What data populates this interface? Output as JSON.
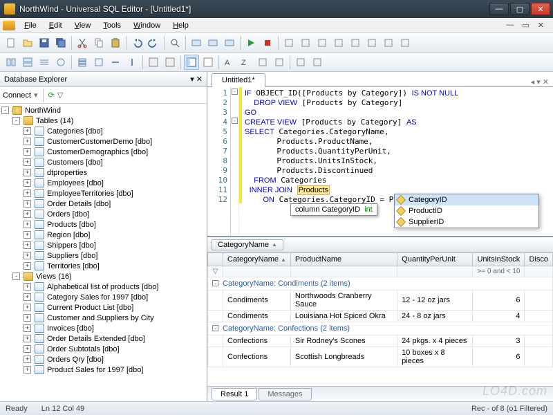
{
  "window": {
    "title": "NorthWind - Universal SQL Editor - [Untitled1*]"
  },
  "menu": [
    "File",
    "Edit",
    "View",
    "Tools",
    "Window",
    "Help"
  ],
  "sidebar": {
    "title": "Database Explorer",
    "connect_label": "Connect",
    "root": "NorthWind",
    "tables_label": "Tables (14)",
    "tables": [
      "Categories [dbo]",
      "CustomerCustomerDemo [dbo]",
      "CustomerDemographics [dbo]",
      "Customers [dbo]",
      "dtproperties",
      "Employees [dbo]",
      "EmployeeTerritories [dbo]",
      "Order Details [dbo]",
      "Orders [dbo]",
      "Products [dbo]",
      "Region [dbo]",
      "Shippers [dbo]",
      "Suppliers [dbo]",
      "Territories [dbo]"
    ],
    "views_label": "Views (16)",
    "views": [
      "Alphabetical list of products [dbo]",
      "Category Sales for 1997 [dbo]",
      "Current Product List [dbo]",
      "Customer and Suppliers by City",
      "Invoices [dbo]",
      "Order Details Extended [dbo]",
      "Order Subtotals [dbo]",
      "Orders Qry [dbo]",
      "Product Sales for 1997 [dbo]"
    ]
  },
  "editor": {
    "tab": "Untitled1*",
    "lines": [
      {
        "n": 1,
        "html": "<span class='kw'>IF</span> OBJECT_ID([Products by Category]) <span class='kw'>IS NOT NULL</span>"
      },
      {
        "n": 2,
        "html": "  <span class='kw'>DROP VIEW</span> [Products by Category]"
      },
      {
        "n": 3,
        "html": "<span class='kw'>GO</span>"
      },
      {
        "n": 4,
        "html": "<span class='kw'>CREATE VIEW</span> [Products by Category] <span class='kw'>AS</span>"
      },
      {
        "n": 5,
        "html": "<span class='kw'>SELECT</span> Categories.CategoryName,"
      },
      {
        "n": 6,
        "html": "       Products.ProductName,"
      },
      {
        "n": 7,
        "html": "       Products.QuantityPerUnit,"
      },
      {
        "n": 8,
        "html": "       Products.UnitsInStock,"
      },
      {
        "n": 9,
        "html": "       Products.Discontinued"
      },
      {
        "n": 10,
        "html": "  <span class='kw'>FROM</span> Categories"
      },
      {
        "n": 11,
        "html": " <span class='kw'>INNER JOIN</span> <span class='tok-hi'>Products</span>"
      },
      {
        "n": 12,
        "html": "    <span class='kw'>ON</span> Categories.CategoryID = Products.*id|"
      }
    ],
    "hint": {
      "label": "column CategoryID",
      "type": "int"
    },
    "suggestions": [
      "CategoryID",
      "ProductID",
      "SupplierID"
    ]
  },
  "results": {
    "group_chip": "CategoryName",
    "columns": [
      "CategoryName",
      "ProductName",
      "QuantityPerUnit",
      "UnitsInStock",
      "Disco"
    ],
    "filter_hint": ">= 0 and < 10",
    "groups": [
      {
        "header": "CategoryName: Condiments (2 items)",
        "rows": [
          [
            "Condiments",
            "Northwoods Cranberry Sauce",
            "12 - 12 oz jars",
            "6",
            ""
          ],
          [
            "Condiments",
            "Louisiana Hot Spiced Okra",
            "24 - 8 oz jars",
            "4",
            ""
          ]
        ]
      },
      {
        "header": "CategoryName: Confections (2 items)",
        "rows": [
          [
            "Confections",
            "Sir Rodney's Scones",
            "24 pkgs. x 4 pieces",
            "3",
            ""
          ],
          [
            "Confections",
            "Scottish Longbreads",
            "10 boxes x 8 pieces",
            "6",
            ""
          ]
        ]
      }
    ],
    "tabs": [
      "Result 1",
      "Messages"
    ]
  },
  "status": {
    "left": "Ready",
    "pos": "Ln 12   Col 49",
    "right": "Rec - of 8 (o1 Filtered)"
  },
  "watermark": "LO4D.com"
}
